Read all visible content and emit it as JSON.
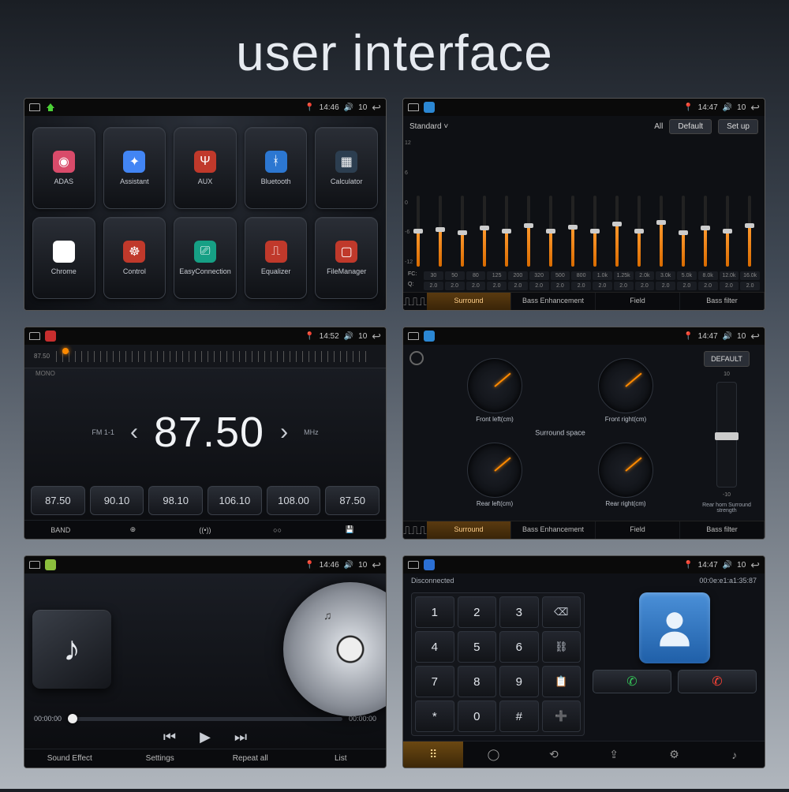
{
  "page_title": "user interface",
  "statusbar": {
    "time1": "14:46",
    "time2": "14:47",
    "time3": "14:52",
    "time4": "14:47",
    "time5": "14:46",
    "time6": "14:47",
    "vol": "10"
  },
  "apps": [
    {
      "label": "ADAS",
      "color": "#d94b6a"
    },
    {
      "label": "Assistant",
      "color": "#4285f4"
    },
    {
      "label": "AUX",
      "color": "#c0392b"
    },
    {
      "label": "Bluetooth",
      "color": "#2c77d1"
    },
    {
      "label": "Calculator",
      "color": "#2c3e50"
    },
    {
      "label": "Chrome",
      "color": "#fff"
    },
    {
      "label": "Control",
      "color": "#c0392b"
    },
    {
      "label": "EasyConnection",
      "color": "#16a085"
    },
    {
      "label": "Equalizer",
      "color": "#c0392b"
    },
    {
      "label": "FileManager",
      "color": "#c0392b"
    }
  ],
  "eq": {
    "preset": "Standard",
    "all": "All",
    "default": "Default",
    "setup": "Set up",
    "scale": [
      "12",
      "6",
      "0",
      "-6",
      "-12"
    ],
    "fc_label": "FC:",
    "fc": [
      "30",
      "50",
      "80",
      "125",
      "200",
      "320",
      "500",
      "800",
      "1.0k",
      "1.25k",
      "2.0k",
      "3.0k",
      "5.0k",
      "8.0k",
      "12.0k",
      "16.0k"
    ],
    "q_label": "Q:",
    "q": [
      "2.0",
      "2.0",
      "2.0",
      "2.0",
      "2.0",
      "2.0",
      "2.0",
      "2.0",
      "2.0",
      "2.0",
      "2.0",
      "2.0",
      "2.0",
      "2.0",
      "2.0",
      "2.0"
    ],
    "levels": [
      50,
      52,
      48,
      55,
      50,
      58,
      50,
      56,
      50,
      60,
      50,
      62,
      48,
      55,
      50,
      58
    ],
    "tabs": [
      "Surround",
      "Bass Enhancement",
      "Field",
      "Bass filter"
    ]
  },
  "radio": {
    "dial_start": "87.50",
    "mono": "MONO",
    "band": "FM 1-1",
    "freq": "87.50",
    "unit": "MHz",
    "presets": [
      "87.50",
      "90.10",
      "98.10",
      "106.10",
      "108.00",
      "87.50"
    ],
    "bottom": [
      "BAND",
      "⊕",
      "((•))",
      "○○",
      "💾"
    ]
  },
  "surround": {
    "default": "DEFAULT",
    "gauges": [
      "Front left(cm)",
      "Front right(cm)",
      "Rear left(cm)",
      "Rear right(cm)"
    ],
    "center": "Surround space",
    "right_label": "Rear horn Surround strength",
    "scale_top": "10",
    "scale_bot": "-10",
    "tabs": [
      "Surround",
      "Bass Enhancement",
      "Field",
      "Bass filter"
    ]
  },
  "player": {
    "t0": "00:00:00",
    "t1": "00:00:00",
    "bottom": [
      "Sound Effect",
      "Settings",
      "Repeat all",
      "List"
    ]
  },
  "dialer": {
    "status": "Disconnected",
    "mac": "00:0e:e1:a1:35:87",
    "keys": [
      "1",
      "2",
      "3",
      "⌫",
      "4",
      "5",
      "6",
      "⛓",
      "7",
      "8",
      "9",
      "📋",
      "*",
      "0",
      "#",
      "➕"
    ]
  }
}
